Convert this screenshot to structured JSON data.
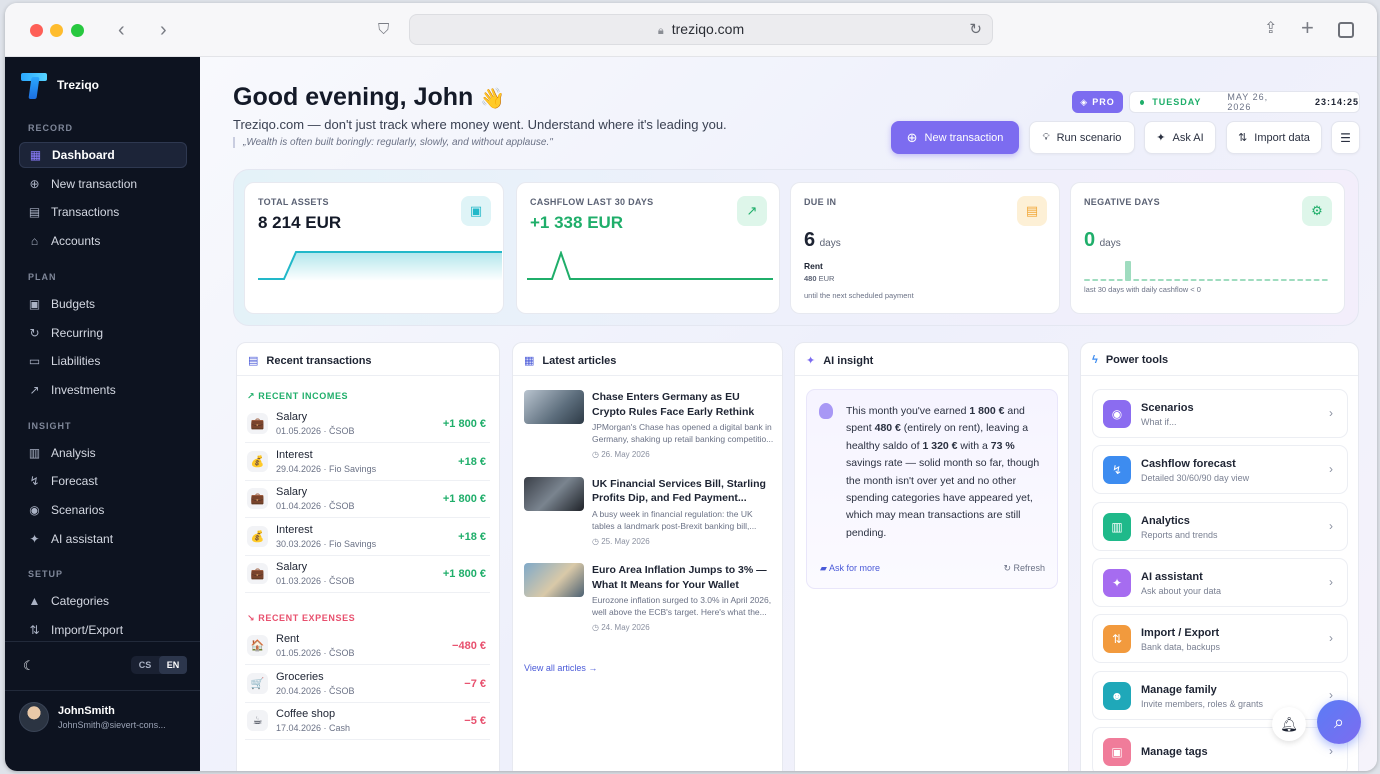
{
  "browser": {
    "url": "treziqo.com"
  },
  "sidebar": {
    "brand": "Treziqo",
    "sections": [
      {
        "title": "RECORD",
        "items": [
          {
            "label": "Dashboard",
            "icon": "grid-icon",
            "active": true
          },
          {
            "label": "New transaction",
            "icon": "plus-circle-icon"
          },
          {
            "label": "Transactions",
            "icon": "receipt-icon"
          },
          {
            "label": "Accounts",
            "icon": "bank-icon"
          }
        ]
      },
      {
        "title": "PLAN",
        "items": [
          {
            "label": "Budgets",
            "icon": "wallet-icon"
          },
          {
            "label": "Recurring",
            "icon": "repeat-icon"
          },
          {
            "label": "Liabilities",
            "icon": "card-icon"
          },
          {
            "label": "Investments",
            "icon": "trend-icon"
          }
        ]
      },
      {
        "title": "INSIGHT",
        "items": [
          {
            "label": "Analysis",
            "icon": "bar-chart-icon"
          },
          {
            "label": "Forecast",
            "icon": "forecast-icon"
          },
          {
            "label": "Scenarios",
            "icon": "bulb-icon"
          },
          {
            "label": "AI assistant",
            "icon": "sparkle-icon"
          }
        ]
      },
      {
        "title": "SETUP",
        "items": [
          {
            "label": "Categories",
            "icon": "shapes-icon"
          },
          {
            "label": "Import/Export",
            "icon": "swap-icon"
          }
        ]
      }
    ],
    "lang": {
      "cs": "CS",
      "en": "EN"
    },
    "user": {
      "name": "JohnSmith",
      "email": "JohnSmith@sievert-cons..."
    }
  },
  "header": {
    "greeting": "Good evening, John",
    "wave": "👋",
    "subtitle": "Treziqo.com — don't just track where money went. Understand where it's leading you.",
    "quote": "„Wealth is often built boringly: regularly, slowly, and without applause.\"",
    "pro": "PRO",
    "day": "TUESDAY",
    "date": "MAY 26, 2026",
    "time": "23:14:25"
  },
  "actions": {
    "new": "New transaction",
    "scenario": "Run scenario",
    "ai": "Ask AI",
    "import": "Import data"
  },
  "kpis": {
    "assets": {
      "title": "TOTAL ASSETS",
      "value": "8 214 EUR"
    },
    "cashflow": {
      "title": "CASHFLOW LAST 30 DAYS",
      "value": "+1 338 EUR"
    },
    "due": {
      "title": "DUE IN",
      "value": "6",
      "unit": "days",
      "name": "Rent",
      "amount": "480",
      "currency": "EUR",
      "note": "until the next scheduled payment"
    },
    "negative": {
      "title": "NEGATIVE DAYS",
      "value": "0",
      "unit": "days",
      "note": "last 30 days with daily cashflow < 0"
    }
  },
  "recent": {
    "title": "Recent transactions",
    "incomes_label": "RECENT INCOMES",
    "expenses_label": "RECENT EXPENSES",
    "incomes": [
      {
        "name": "Salary",
        "date": "01.05.2026",
        "account": "ČSOB",
        "amount": "+1 800 €",
        "icon": "briefcase-icon",
        "glyph": "💼"
      },
      {
        "name": "Interest",
        "date": "29.04.2026",
        "account": "Fio Savings",
        "amount": "+18 €",
        "icon": "money-bag-icon",
        "glyph": "💰"
      },
      {
        "name": "Salary",
        "date": "01.04.2026",
        "account": "ČSOB",
        "amount": "+1 800 €",
        "icon": "briefcase-icon",
        "glyph": "💼"
      },
      {
        "name": "Interest",
        "date": "30.03.2026",
        "account": "Fio Savings",
        "amount": "+18 €",
        "icon": "money-bag-icon",
        "glyph": "💰"
      },
      {
        "name": "Salary",
        "date": "01.03.2026",
        "account": "ČSOB",
        "amount": "+1 800 €",
        "icon": "briefcase-icon",
        "glyph": "💼"
      }
    ],
    "expenses": [
      {
        "name": "Rent",
        "date": "01.05.2026",
        "account": "ČSOB",
        "amount": "−480 €",
        "icon": "house-icon",
        "glyph": "🏠"
      },
      {
        "name": "Groceries",
        "date": "20.04.2026",
        "account": "ČSOB",
        "amount": "−7 €",
        "icon": "cart-icon",
        "glyph": "🛒"
      },
      {
        "name": "Coffee shop",
        "date": "17.04.2026",
        "account": "Cash",
        "amount": "−5 €",
        "icon": "coffee-icon",
        "glyph": "☕"
      }
    ]
  },
  "articles": {
    "title": "Latest articles",
    "items": [
      {
        "title": "Chase Enters Germany as EU Crypto Rules Face Early Rethink",
        "excerpt": "JPMorgan's Chase has opened a digital bank in Germany, shaking up retail banking competitio...",
        "date": "26. May 2026"
      },
      {
        "title": "UK Financial Services Bill, Starling Profits Dip, and Fed Payment...",
        "excerpt": "A busy week in financial regulation: the UK tables a landmark post-Brexit banking bill,...",
        "date": "25. May 2026"
      },
      {
        "title": "Euro Area Inflation Jumps to 3% — What It Means for Your Wallet",
        "excerpt": "Eurozone inflation surged to 3.0% in April 2026, well above the ECB's target. Here's what the...",
        "date": "24. May 2026"
      }
    ],
    "view_all": "View all articles →"
  },
  "ai": {
    "title": "AI insight",
    "t1": "This month you've earned ",
    "b1": "1 800 €",
    "t2": " and spent ",
    "b2": "480 €",
    "t3": " (entirely on rent), leaving a healthy saldo of ",
    "b3": "1 320 €",
    "t4": " with a ",
    "b4": "73 %",
    "t5": " savings rate — solid month so far, though the month isn't over yet and no other spending categories have appeared yet, which may mean transactions are still pending.",
    "ask": "Ask for more",
    "refresh": "Refresh"
  },
  "tools": {
    "title": "Power tools",
    "items": [
      {
        "title": "Scenarios",
        "sub": "What if...",
        "color": "#8b6cf0",
        "icon": "bulb-icon"
      },
      {
        "title": "Cashflow forecast",
        "sub": "Detailed 30/60/90 day view",
        "color": "#3d8cf0",
        "icon": "forecast-icon"
      },
      {
        "title": "Analytics",
        "sub": "Reports and trends",
        "color": "#1fb98a",
        "icon": "analytics-icon"
      },
      {
        "title": "AI assistant",
        "sub": "Ask about your data",
        "color": "#a66cf0",
        "icon": "sparkle-icon"
      },
      {
        "title": "Import / Export",
        "sub": "Bank data, backups",
        "color": "#f29a3d",
        "icon": "swap-icon"
      },
      {
        "title": "Manage family",
        "sub": "Invite members, roles & grants",
        "color": "#1fa8b9",
        "icon": "users-icon"
      },
      {
        "title": "Manage tags",
        "sub": "",
        "color": "#f07c9a",
        "icon": "tag-icon"
      }
    ]
  },
  "colors": {
    "accent": "#7c6cf0",
    "income": "#1fae6a",
    "expense": "#e8506e",
    "teal": "#22b8c9"
  }
}
